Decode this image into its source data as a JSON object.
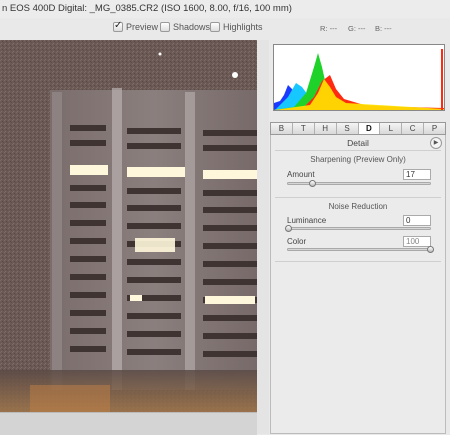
{
  "title": "n EOS 400D Digital:  _MG_0385.CR2  (ISO 1600, 8.00, f/16, 100 mm)",
  "options": [
    {
      "label": "Preview",
      "checked": true
    },
    {
      "label": "Shadows",
      "checked": false
    },
    {
      "label": "Highlights",
      "checked": false
    }
  ],
  "readout": {
    "r": "R: ---",
    "g": "G: ---",
    "b": "B: ---"
  },
  "tabs": [
    "B",
    "T",
    "H",
    "S",
    "D",
    "L",
    "C",
    "P"
  ],
  "active_tab": "D",
  "panel": {
    "title": "Detail",
    "sharpening": {
      "title": "Sharpening  (Preview Only)",
      "amount_label": "Amount",
      "amount_value": "17",
      "amount_fraction": 0.17
    },
    "noise": {
      "title": "Noise Reduction",
      "luminance_label": "Luminance",
      "luminance_value": "0",
      "luminance_fraction": 0,
      "color_label": "Color",
      "color_value": "100",
      "color_fraction": 1
    }
  },
  "colors": {
    "red": "#ff2a10",
    "green": "#1fd22a",
    "blue": "#1a3bff",
    "cyan": "#16c8ff",
    "yellow": "#ffe400"
  }
}
